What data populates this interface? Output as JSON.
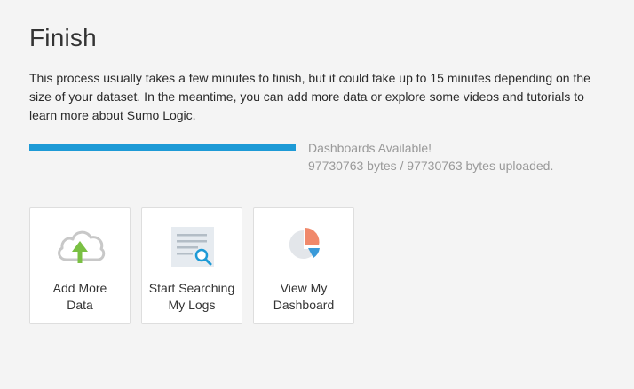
{
  "header": {
    "title": "Finish"
  },
  "description": "This process usually takes a few minutes to finish, but it could take up to 15 minutes depending on the size of your dataset. In the meantime, you can add more data or explore some videos and tutorials to learn more about Sumo Logic.",
  "progress": {
    "fraction": 1.0,
    "status_title": "Dashboards Available!",
    "status_detail": "97730763 bytes / 97730763 bytes uploaded.",
    "bar_color": "#1d9ad6"
  },
  "cards": [
    {
      "label_line1": "Add More",
      "label_line2": "Data",
      "icon": "cloud-upload-icon"
    },
    {
      "label_line1": "Start Searching",
      "label_line2": "My Logs",
      "icon": "search-logs-icon"
    },
    {
      "label_line1": "View My",
      "label_line2": "Dashboard",
      "icon": "pie-chart-icon"
    }
  ]
}
